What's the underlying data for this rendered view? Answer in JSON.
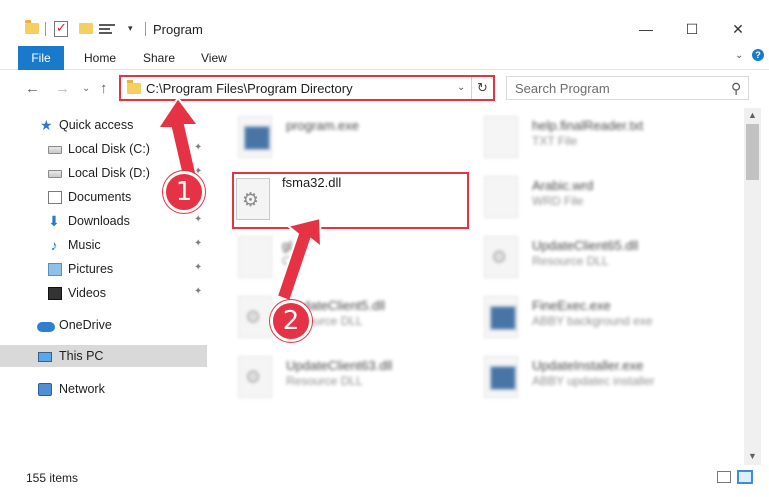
{
  "window": {
    "title": "Program",
    "minimize": "—",
    "maximize": "☐",
    "close": "✕"
  },
  "ribbon": {
    "tabs": [
      "File",
      "Home",
      "Share",
      "View"
    ],
    "expand": "⌄",
    "help": "?"
  },
  "address": {
    "path": "C:\\Program Files\\Program Directory",
    "dropdown": "⌄",
    "refresh": "↻"
  },
  "search": {
    "placeholder": "Search Program"
  },
  "nav_buttons": {
    "back": "←",
    "forward": "→",
    "recent": "⌄",
    "up": "↑"
  },
  "sidebar": {
    "items": [
      {
        "label": "Quick access",
        "icon": "star-icon",
        "pinned": false
      },
      {
        "label": "Local Disk (C:)",
        "icon": "drive-icon",
        "pinned": true
      },
      {
        "label": "Local Disk (D:)",
        "icon": "drive-icon",
        "pinned": true
      },
      {
        "label": "Documents",
        "icon": "documents-icon",
        "pinned": true
      },
      {
        "label": "Downloads",
        "icon": "download-icon",
        "pinned": true
      },
      {
        "label": "Music",
        "icon": "music-icon",
        "pinned": true
      },
      {
        "label": "Pictures",
        "icon": "pictures-icon",
        "pinned": true
      },
      {
        "label": "Videos",
        "icon": "videos-icon",
        "pinned": true
      },
      {
        "label": "OneDrive",
        "icon": "onedrive-icon",
        "pinned": false
      },
      {
        "label": "This PC",
        "icon": "this-pc-icon",
        "pinned": false,
        "selected": true
      },
      {
        "label": "Network",
        "icon": "network-icon",
        "pinned": false
      }
    ],
    "pin_glyph": "📌"
  },
  "files": {
    "left": [
      {
        "name": "program.exe",
        "type": ""
      },
      {
        "name": "fsma32.dll",
        "type": ""
      },
      {
        "name": "gl",
        "type": "CR"
      },
      {
        "name": "UpdateClient5.dll",
        "type": "Resource DLL"
      },
      {
        "name": "UpdateClient63.dll",
        "type": "Resource DLL"
      }
    ],
    "right": [
      {
        "name": "help.finalReader.txt",
        "type": "TXT File"
      },
      {
        "name": "Arabic.wrd",
        "type": "WRD File"
      },
      {
        "name": "UpdateClient65.dll",
        "type": "Resource DLL"
      },
      {
        "name": "FineExec.exe",
        "type": "ABBY background exe"
      },
      {
        "name": "UpdateInstaller.exe",
        "type": "ABBY updatec installer"
      }
    ]
  },
  "annotations": {
    "step1": "1",
    "step2": "2",
    "color": "#e53244"
  },
  "status": {
    "count": "155 items"
  }
}
